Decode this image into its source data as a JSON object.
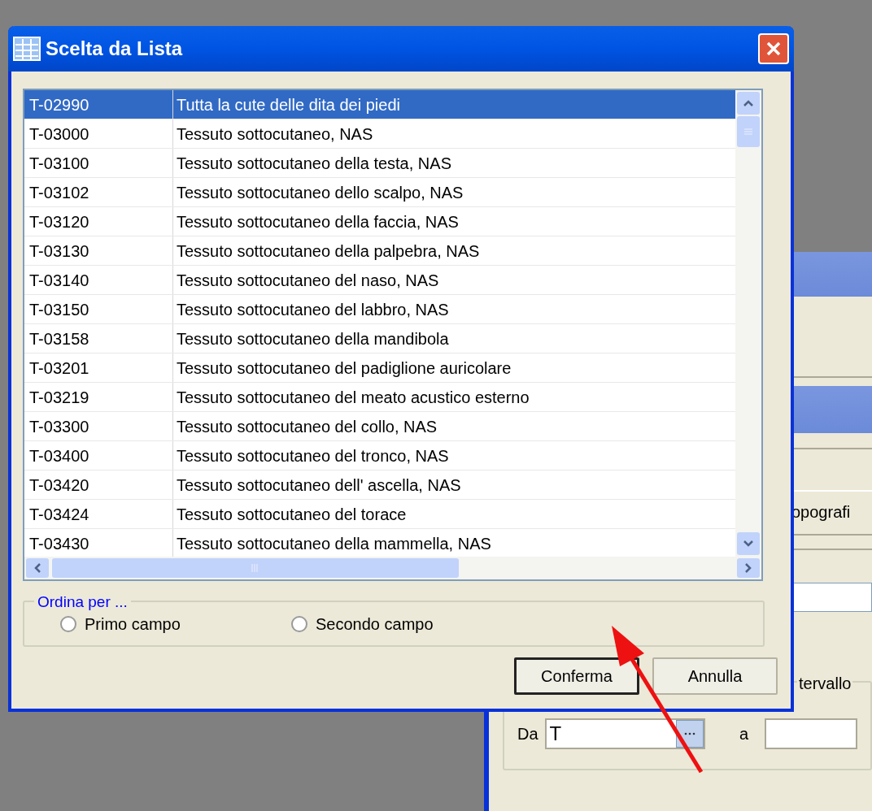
{
  "dialog": {
    "title": "Scelta da Lista",
    "rows": [
      {
        "code": "T-02990",
        "description": "Tutta la cute delle dita dei piedi",
        "selected": true
      },
      {
        "code": "T-03000",
        "description": "Tessuto sottocutaneo, NAS",
        "selected": false
      },
      {
        "code": "T-03100",
        "description": "Tessuto sottocutaneo della testa, NAS",
        "selected": false
      },
      {
        "code": "T-03102",
        "description": "Tessuto sottocutaneo dello scalpo, NAS",
        "selected": false
      },
      {
        "code": "T-03120",
        "description": "Tessuto sottocutaneo della faccia, NAS",
        "selected": false
      },
      {
        "code": "T-03130",
        "description": "Tessuto sottocutaneo della palpebra, NAS",
        "selected": false
      },
      {
        "code": "T-03140",
        "description": "Tessuto sottocutaneo del naso, NAS",
        "selected": false
      },
      {
        "code": "T-03150",
        "description": "Tessuto sottocutaneo del labbro, NAS",
        "selected": false
      },
      {
        "code": "T-03158",
        "description": "Tessuto sottocutaneo della mandibola",
        "selected": false
      },
      {
        "code": "T-03201",
        "description": "Tessuto sottocutaneo del padiglione auricolare",
        "selected": false
      },
      {
        "code": "T-03219",
        "description": "Tessuto sottocutaneo del meato acustico esterno",
        "selected": false
      },
      {
        "code": "T-03300",
        "description": "Tessuto sottocutaneo del collo, NAS",
        "selected": false
      },
      {
        "code": "T-03400",
        "description": "Tessuto sottocutaneo del tronco, NAS",
        "selected": false
      },
      {
        "code": "T-03420",
        "description": "Tessuto sottocutaneo dell' ascella, NAS",
        "selected": false
      },
      {
        "code": "T-03424",
        "description": "Tessuto sottocutaneo del torace",
        "selected": false
      },
      {
        "code": "T-03430",
        "description": "Tessuto sottocutaneo della mammella, NAS",
        "selected": false
      }
    ],
    "sort_group": {
      "label": "Ordina per ...",
      "options": [
        {
          "label": "Primo campo",
          "selected": false
        },
        {
          "label": "Secondo campo",
          "selected": false
        }
      ]
    },
    "buttons": [
      {
        "label": "Conferma",
        "default": true
      },
      {
        "label": "Annulla",
        "default": false
      }
    ]
  },
  "background_window": {
    "label": "opografi",
    "range_group": {
      "label": "tervallo",
      "from_label": "Da",
      "from_value": "T",
      "to_label": "a"
    }
  }
}
